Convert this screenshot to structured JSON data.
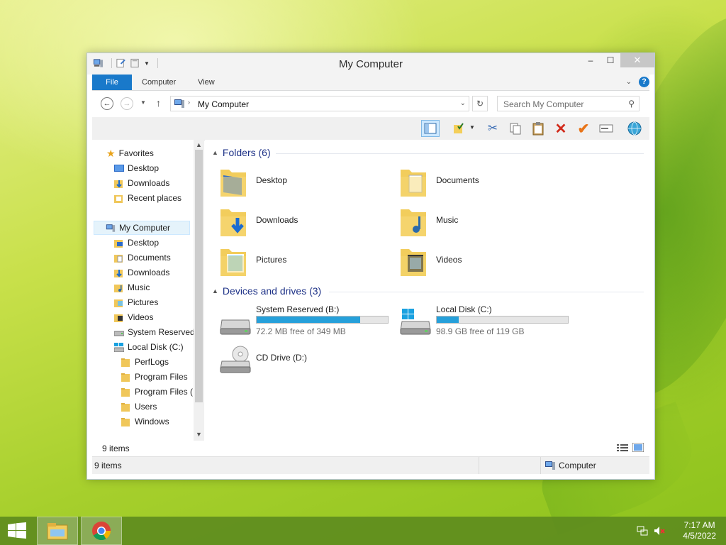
{
  "window": {
    "title": "My Computer",
    "controls": {
      "minimize": "–",
      "maximize": "☐",
      "close": "✕"
    }
  },
  "ribbon": {
    "tabs": [
      {
        "label": "File"
      },
      {
        "label": "Computer"
      },
      {
        "label": "View"
      }
    ]
  },
  "address": {
    "path": "My Computer",
    "search_placeholder": "Search My Computer"
  },
  "nav": {
    "favorites_header": "Favorites",
    "favorites": [
      {
        "label": "Desktop"
      },
      {
        "label": "Downloads"
      },
      {
        "label": "Recent places"
      }
    ],
    "computer_header": "My Computer",
    "computer_items": [
      {
        "label": "Desktop"
      },
      {
        "label": "Documents"
      },
      {
        "label": "Downloads"
      },
      {
        "label": "Music"
      },
      {
        "label": "Pictures"
      },
      {
        "label": "Videos"
      },
      {
        "label": "System Reserved"
      },
      {
        "label": "Local Disk (C:)"
      }
    ],
    "disk_items": [
      {
        "label": "PerfLogs"
      },
      {
        "label": "Program Files"
      },
      {
        "label": "Program Files ("
      },
      {
        "label": "Users"
      },
      {
        "label": "Windows"
      }
    ]
  },
  "main": {
    "folders_header": "Folders (6)",
    "folders": [
      {
        "label": "Desktop"
      },
      {
        "label": "Documents"
      },
      {
        "label": "Downloads"
      },
      {
        "label": "Music"
      },
      {
        "label": "Pictures"
      },
      {
        "label": "Videos"
      }
    ],
    "drives_header": "Devices and drives (3)",
    "drives": [
      {
        "name": "System Reserved (B:)",
        "free": "72.2 MB free of 349 MB",
        "used_fraction": 0.79
      },
      {
        "name": "Local Disk (C:)",
        "free": "98.9 GB free of 119 GB",
        "used_fraction": 0.17
      },
      {
        "name": "CD Drive (D:)"
      }
    ],
    "item_count": "9 items"
  },
  "status": {
    "left": "9 items",
    "right": "Computer"
  },
  "taskbar": {
    "time": "7:17 AM",
    "date": "4/5/2022"
  },
  "colors": {
    "accent": "#1979ca",
    "progress": "#26a0da",
    "group_header": "#1e3287"
  }
}
